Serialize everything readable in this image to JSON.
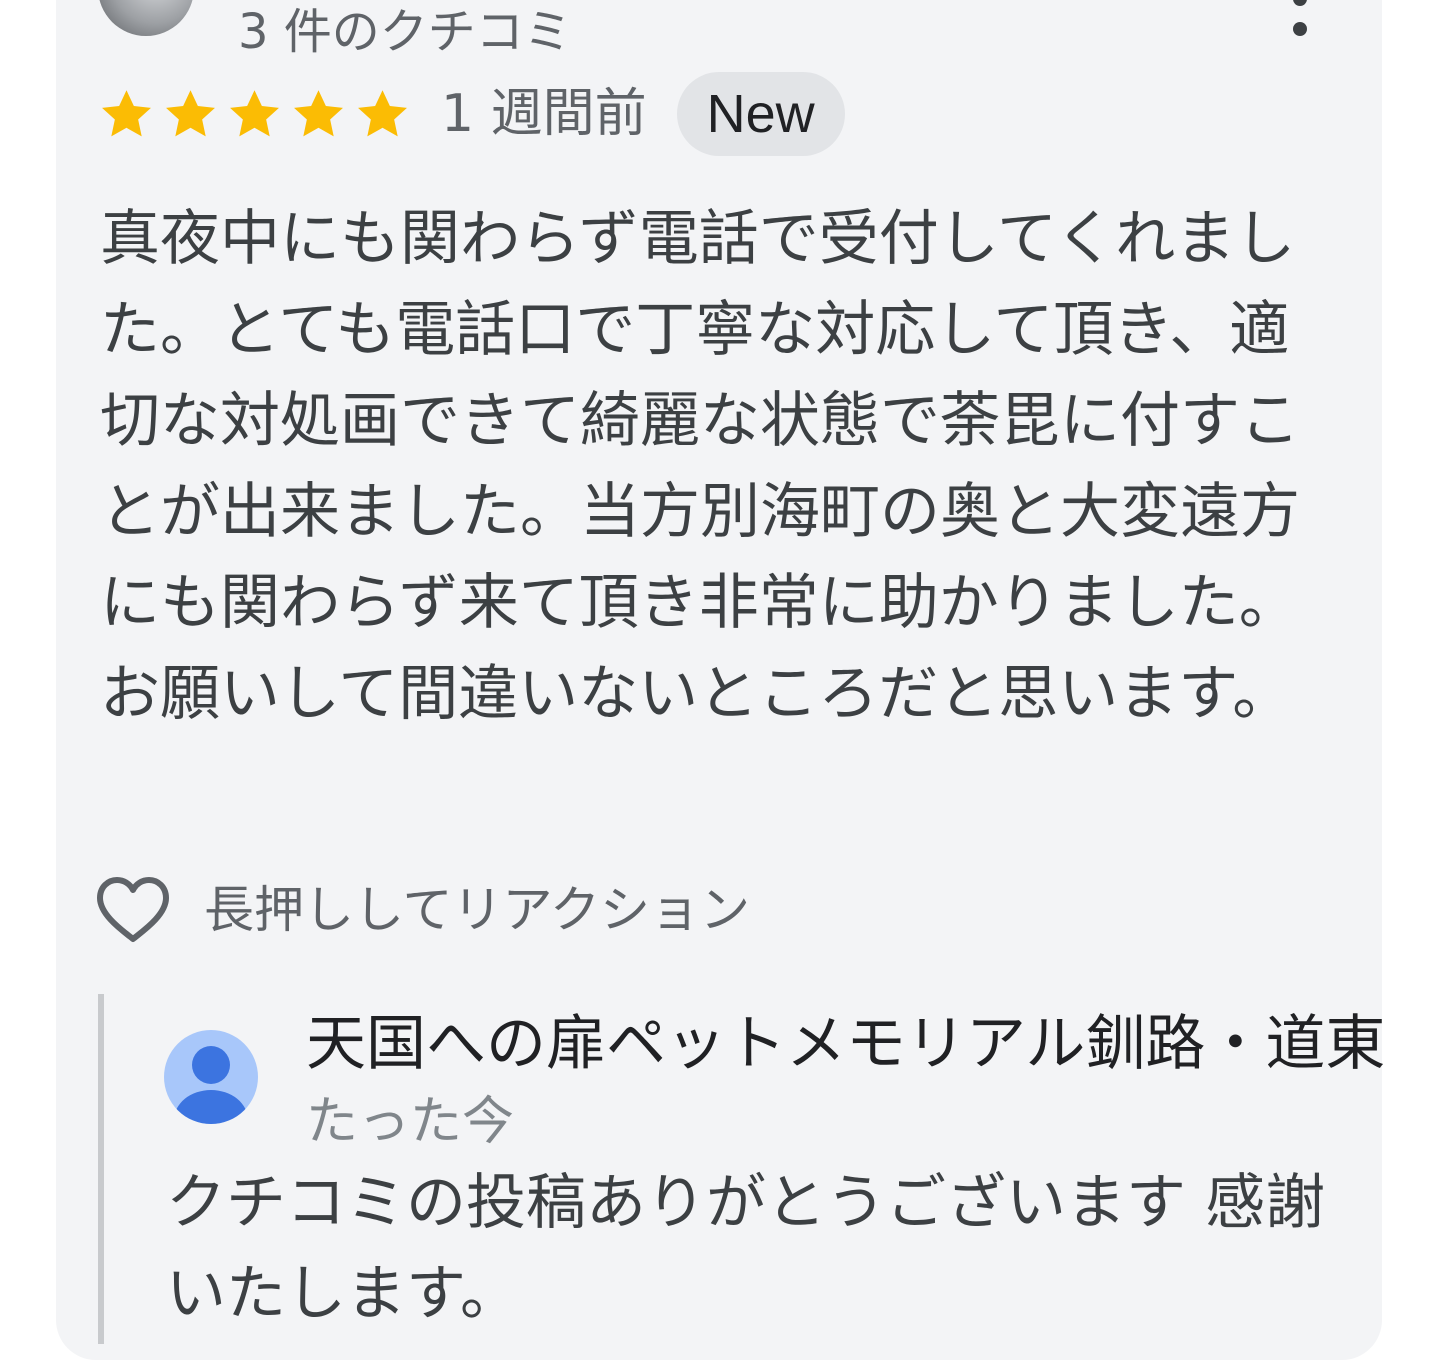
{
  "review": {
    "review_count": "3 件のクチコミ",
    "rating_stars": 5,
    "time_ago": "1 週間前",
    "new_badge": "New",
    "text": "真夜中にも関わらず電話で受付してくれました。とても電話口で丁寧な対応して頂き、適切な対処画できて綺麗な状態で荼毘に付すことが出来ました。当方別海町の奥と大変遠方にも関わらず来て頂き非常に助かりました。お願いして間違いないところだと思います。",
    "reaction_label": "長押ししてリアクション",
    "star_color": "#fbbc04"
  },
  "reply": {
    "owner_name": "天国への扉ペットメモリアル釧路・道東",
    "time_ago": "たった今",
    "text": "クチコミの投稿ありがとうございます 感謝いたします。",
    "avatar_color": "#a8c7fa",
    "avatar_icon_color": "#3c74e0"
  }
}
